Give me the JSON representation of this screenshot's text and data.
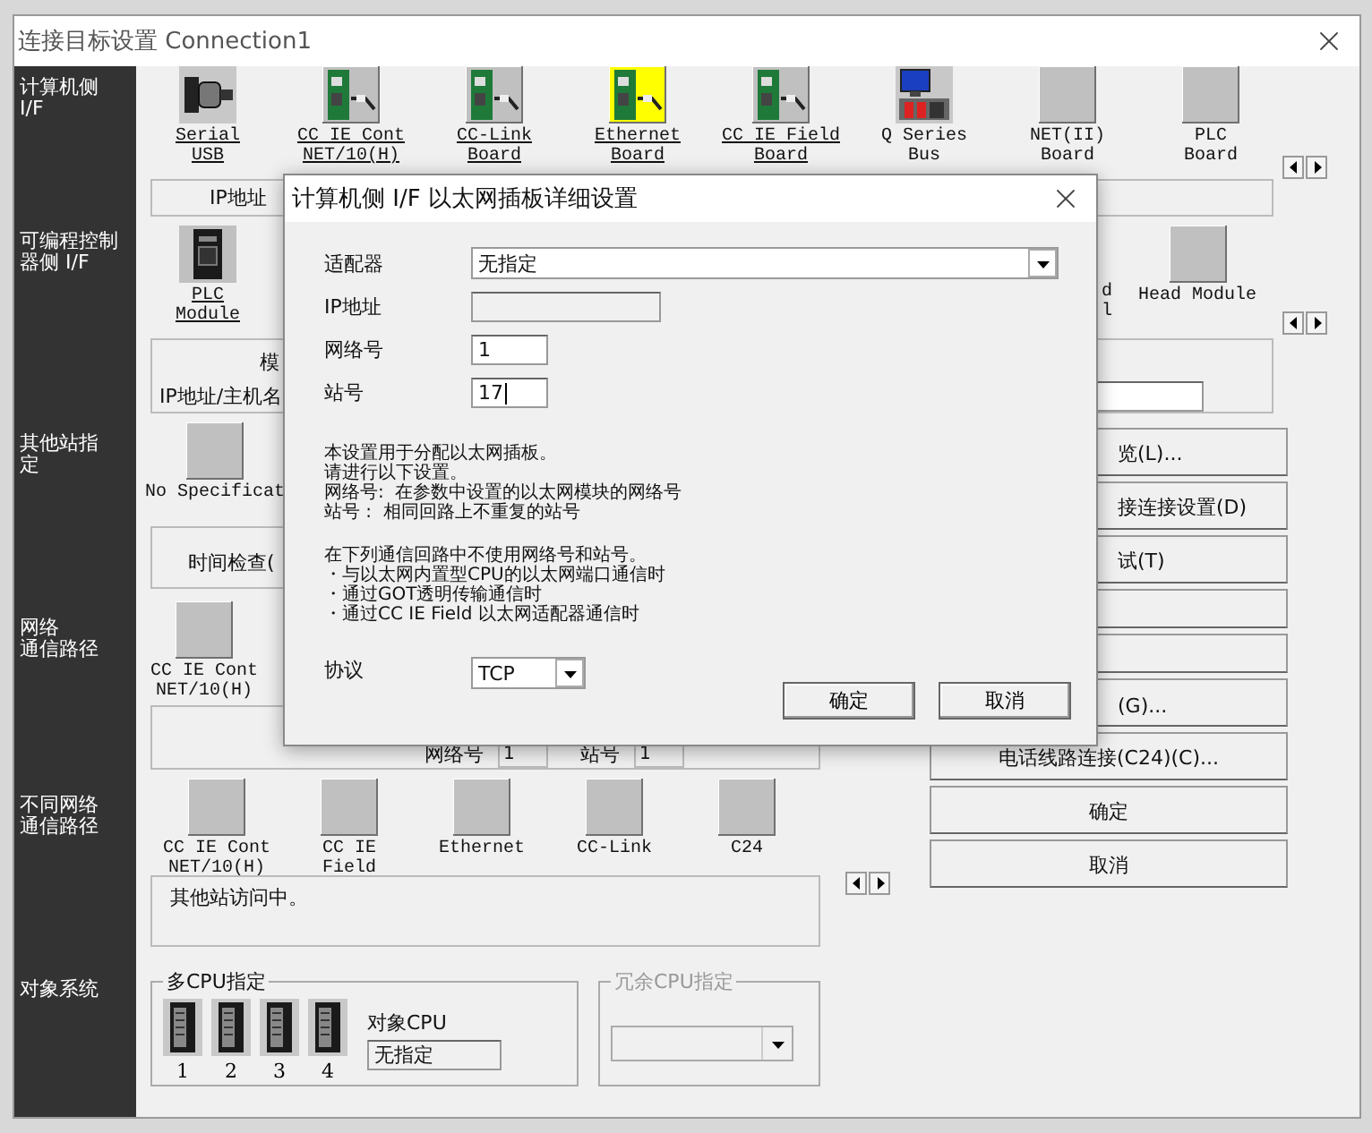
{
  "window": {
    "title": "连接目标设置 Connection1"
  },
  "sidebar": [
    {
      "lines": [
        "计算机侧",
        "I/F"
      ]
    },
    {
      "lines": [
        "可编程控制",
        "器侧 I/F"
      ]
    },
    {
      "lines": [
        "其他站指",
        "定"
      ]
    },
    {
      "lines": [
        "网络",
        "通信路径"
      ]
    },
    {
      "lines": [
        "不同网络",
        "通信路径"
      ]
    },
    {
      "lines": [
        "对象系统"
      ]
    }
  ],
  "pc_side": {
    "options": [
      {
        "label": "Serial\nUSB",
        "kind": "serial",
        "enabled": true,
        "selected": false
      },
      {
        "label": "CC IE Cont\nNET/10(H)",
        "kind": "board",
        "enabled": true,
        "selected": false
      },
      {
        "label": "CC-Link\nBoard",
        "kind": "board",
        "enabled": true,
        "selected": false
      },
      {
        "label": "Ethernet\nBoard",
        "kind": "board",
        "enabled": true,
        "selected": true
      },
      {
        "label": "CC IE Field\nBoard",
        "kind": "board",
        "enabled": true,
        "selected": false
      },
      {
        "label": "Q Series\nBus",
        "kind": "bus",
        "enabled": false,
        "selected": false
      },
      {
        "label": "NET(II)\nBoard",
        "kind": "blank",
        "enabled": false,
        "selected": false
      },
      {
        "label": "PLC\nBoard",
        "kind": "blank",
        "enabled": false,
        "selected": false
      }
    ],
    "ip_label": "IP地址"
  },
  "plc_side": {
    "options": [
      {
        "label": "PLC\nModule",
        "kind": "plc",
        "enabled": true,
        "selected": false
      },
      {
        "label": "Head Module",
        "kind": "blank",
        "enabled": false,
        "selected": false
      }
    ],
    "cut_label": "d\nl",
    "panel_title": "模",
    "host_label": "IP地址/主机名"
  },
  "other_station": {
    "options": [
      {
        "label": "No Specificat",
        "kind": "blank",
        "enabled": false,
        "selected": false
      }
    ],
    "time_label": "时间检查("
  },
  "network_route": {
    "options": [
      {
        "label": "CC IE Cont\nNET/10(H)",
        "kind": "blank",
        "enabled": false,
        "selected": false
      }
    ],
    "network_label": "网络号",
    "network_no": "1",
    "station_label": "站号",
    "station_no": "1"
  },
  "other_network_route": {
    "options": [
      {
        "label": "CC IE Cont\nNET/10(H)",
        "kind": "blank",
        "enabled": false,
        "selected": false
      },
      {
        "label": "CC IE\nField",
        "kind": "blank",
        "enabled": false,
        "selected": false
      },
      {
        "label": "Ethernet",
        "kind": "blank",
        "enabled": false,
        "selected": false
      },
      {
        "label": "CC-Link",
        "kind": "blank",
        "enabled": false,
        "selected": false
      },
      {
        "label": "C24",
        "kind": "blank",
        "enabled": false,
        "selected": false
      }
    ]
  },
  "status_text": "其他站访问中。",
  "multi_cpu": {
    "title": "多CPU指定",
    "cpus": [
      "1",
      "2",
      "3",
      "4"
    ],
    "target_label": "对象CPU",
    "target_value": "无指定"
  },
  "redundant_cpu": {
    "title": "冗余CPU指定",
    "disabled": true
  },
  "side_buttons": [
    {
      "label": "览(L)...",
      "kind": "partial"
    },
    {
      "label": "接连接设置(D)",
      "kind": "partial"
    },
    {
      "label": "试(T)",
      "kind": "partial"
    },
    {
      "kind": "blank"
    },
    {
      "kind": "blank"
    },
    {
      "label": "(G)...",
      "kind": "partial"
    },
    {
      "label": "电话线路连接(C24)(C)...",
      "kind": "button"
    },
    {
      "label": "确定",
      "kind": "button"
    },
    {
      "label": "取消",
      "kind": "button"
    }
  ],
  "dialog": {
    "title": "计算机侧 I/F 以太网插板详细设置",
    "fields": [
      {
        "label": "适配器",
        "kind": "select",
        "value": "无指定"
      },
      {
        "label": "IP地址",
        "kind": "text",
        "disabled": true,
        "focused": false
      },
      {
        "label": "网络号",
        "kind": "text",
        "value": "1",
        "disabled": false,
        "focused": false
      },
      {
        "label": "站号",
        "kind": "text",
        "value": "17",
        "disabled": false,
        "focused": true
      }
    ],
    "notes": [
      [
        "本设置用于分配以太网插板。",
        "请进行以下设置。",
        "网络号:  在参数中设置的以太网模块的网络号",
        "站号 :  相同回路上不重复的站号"
      ],
      [
        "在下列通信回路中不使用网络号和站号。",
        "・与以太网内置型CPU的以太网端口通信时",
        "・通过GOT透明传输通信时",
        "・通过CC IE Field 以太网适配器通信时"
      ]
    ],
    "protocol": {
      "label": "协议",
      "value": "TCP"
    },
    "buttons": [
      "确定",
      "取消"
    ]
  }
}
